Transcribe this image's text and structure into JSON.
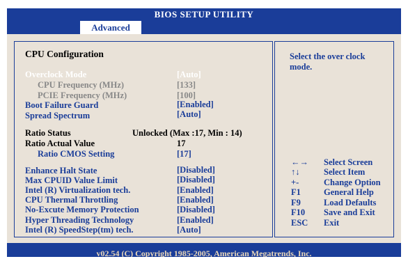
{
  "header": {
    "title": "BIOS SETUP UTILITY",
    "tab": "Advanced"
  },
  "section_title": "CPU Configuration",
  "settings_top": [
    {
      "label": "Overclock Mode",
      "value": "[Auto]"
    },
    {
      "label": "CPU Frequency (MHz)",
      "value": "[133]"
    },
    {
      "label": "PCIE Frequency (MHz)",
      "value": "[100]"
    },
    {
      "label": "Boot Failure Guard",
      "value": "[Enabled]"
    },
    {
      "label": "Spread Spectrum",
      "value": "[Auto]"
    }
  ],
  "ratio_info": {
    "status_label": "Ratio Status",
    "status_value": "Unlocked (Max :17, Min : 14)",
    "actual_label": "Ratio Actual Value",
    "actual_value": "17"
  },
  "ratio_cmos": {
    "label": "Ratio CMOS Setting",
    "value": "[17]"
  },
  "settings_bottom": [
    {
      "label": "Enhance Halt State",
      "value": "[Disabled]"
    },
    {
      "label": "Max CPUID Value Limit",
      "value": "[Disabled]"
    },
    {
      "label": "Intel (R) Virtualization tech.",
      "value": "[Enabled]"
    },
    {
      "label": "CPU Thermal Throttling",
      "value": "[Enabled]"
    },
    {
      "label": "No-Excute Memory Protection",
      "value": "[Disabled]"
    },
    {
      "label": "Hyper Threading Technology",
      "value": "[Enabled]"
    },
    {
      "label": "Intel (R) SpeedStep(tm) tech.",
      "value": "[Auto]"
    }
  ],
  "help": {
    "line1": "Select the over clock",
    "line2": "mode."
  },
  "keys": [
    {
      "key": "←→",
      "desc": "Select Screen"
    },
    {
      "key": "↑↓",
      "desc": "Select Item"
    },
    {
      "key": "+-",
      "desc": "Change Option"
    },
    {
      "key": "F1",
      "desc": "General Help"
    },
    {
      "key": "F9",
      "desc": "Load Defaults"
    },
    {
      "key": "F10",
      "desc": "Save and Exit"
    },
    {
      "key": "ESC",
      "desc": "Exit"
    }
  ],
  "footer": "v02.54 (C) Copyright 1985-2005, American Megatrends, Inc.",
  "colors": {
    "accent": "#1a3d99",
    "panel": "#e9e2d8",
    "selected": "#ffffff",
    "disabled": "#888888"
  }
}
